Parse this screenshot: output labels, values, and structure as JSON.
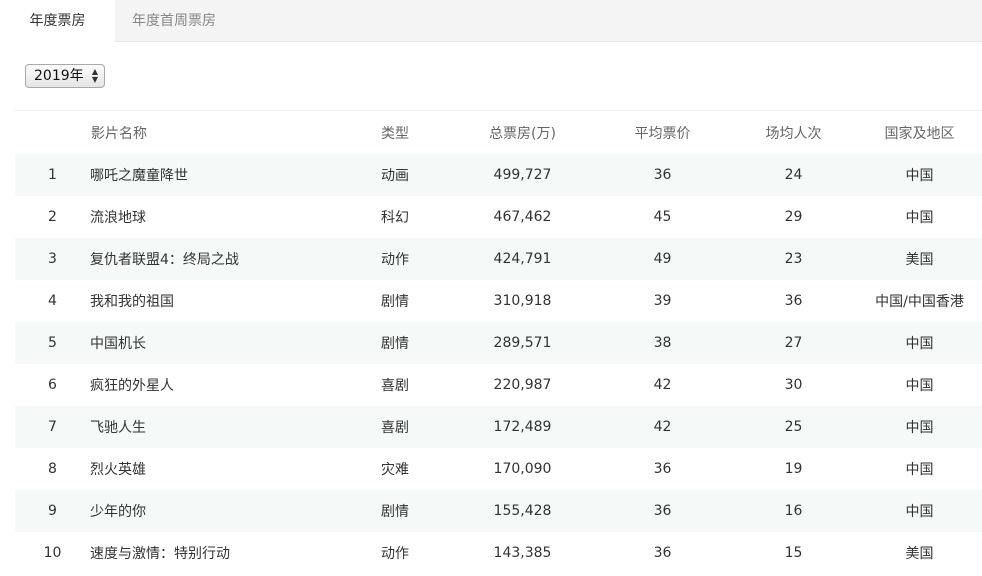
{
  "tabs": [
    {
      "label": "年度票房",
      "active": true
    },
    {
      "label": "年度首周票房",
      "active": false
    }
  ],
  "year_select": {
    "value": "2019年"
  },
  "table": {
    "columns": [
      "",
      "影片名称",
      "类型",
      "总票房(万)",
      "平均票价",
      "场均人次",
      "国家及地区"
    ],
    "rows": [
      {
        "rank": "1",
        "name": "哪吒之魔童降世",
        "type": "动画",
        "box": "499,727",
        "price": "36",
        "audience": "24",
        "country": "中国"
      },
      {
        "rank": "2",
        "name": "流浪地球",
        "type": "科幻",
        "box": "467,462",
        "price": "45",
        "audience": "29",
        "country": "中国"
      },
      {
        "rank": "3",
        "name": "复仇者联盟4：终局之战",
        "type": "动作",
        "box": "424,791",
        "price": "49",
        "audience": "23",
        "country": "美国"
      },
      {
        "rank": "4",
        "name": "我和我的祖国",
        "type": "剧情",
        "box": "310,918",
        "price": "39",
        "audience": "36",
        "country": "中国/中国香港"
      },
      {
        "rank": "5",
        "name": "中国机长",
        "type": "剧情",
        "box": "289,571",
        "price": "38",
        "audience": "27",
        "country": "中国"
      },
      {
        "rank": "6",
        "name": "疯狂的外星人",
        "type": "喜剧",
        "box": "220,987",
        "price": "42",
        "audience": "30",
        "country": "中国"
      },
      {
        "rank": "7",
        "name": "飞驰人生",
        "type": "喜剧",
        "box": "172,489",
        "price": "42",
        "audience": "25",
        "country": "中国"
      },
      {
        "rank": "8",
        "name": "烈火英雄",
        "type": "灾难",
        "box": "170,090",
        "price": "36",
        "audience": "19",
        "country": "中国"
      },
      {
        "rank": "9",
        "name": "少年的你",
        "type": "剧情",
        "box": "155,428",
        "price": "36",
        "audience": "16",
        "country": "中国"
      },
      {
        "rank": "10",
        "name": "速度与激情：特别行动",
        "type": "动作",
        "box": "143,385",
        "price": "36",
        "audience": "15",
        "country": "美国"
      }
    ]
  }
}
